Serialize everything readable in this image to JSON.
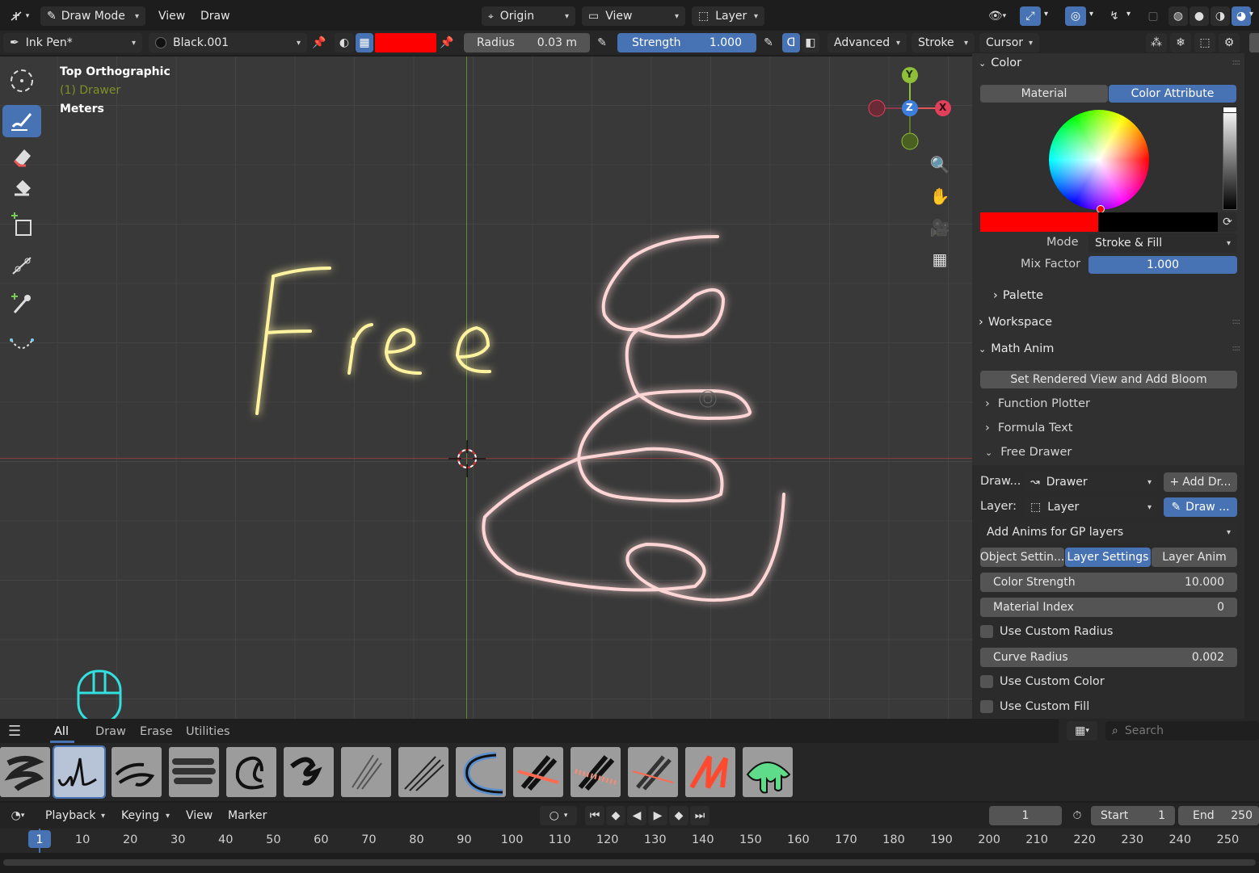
{
  "header": {
    "mode": "Draw Mode",
    "menu": [
      "View",
      "Draw"
    ],
    "origin": "Origin",
    "view_dd": "View",
    "layer_dd": "Layer"
  },
  "toolbar": {
    "brush": "Ink Pen*",
    "material": "Black.001",
    "color": "#ff0000",
    "radius_label": "Radius",
    "radius_value": "0.03 m",
    "strength_label": "Strength",
    "strength_value": "1.000",
    "advanced": "Advanced",
    "stroke": "Stroke",
    "cursor": "Cursor"
  },
  "viewport": {
    "view_name": "Top Orthographic",
    "object": "(1) Drawer",
    "units": "Meters",
    "gizmo": {
      "y": "Y",
      "z": "Z",
      "x": "X"
    },
    "drawing_text": "Free"
  },
  "panel": {
    "color_section": "Color",
    "tab_material": "Material",
    "tab_color_attr": "Color Attribute",
    "current_color": "#ff0000",
    "mode_label": "Mode",
    "mode_value": "Stroke & Fill",
    "mix_label": "Mix Factor",
    "mix_value": "1.000",
    "palette": "Palette",
    "workspace": "Workspace",
    "math_anim": "Math Anim",
    "set_bloom": "Set Rendered View and Add Bloom",
    "function_plotter": "Function Plotter",
    "formula_text": "Formula Text",
    "free_drawer": "Free Drawer",
    "drawer_label": "Draw...",
    "drawer_value": "Drawer",
    "add_drawer": "Add Dr...",
    "layer_label": "Layer:",
    "layer_value": "Layer",
    "draw_btn": "Draw ...",
    "add_anims": "Add Anims for GP layers",
    "tabs": [
      "Object Settin...",
      "Layer Settings",
      "Layer Anim"
    ],
    "color_strength_label": "Color Strength",
    "color_strength_value": "10.000",
    "material_index_label": "Material Index",
    "material_index_value": "0",
    "use_custom_radius": "Use Custom Radius",
    "curve_radius_label": "Curve Radius",
    "curve_radius_value": "0.002",
    "use_custom_color": "Use Custom Color",
    "use_custom_fill": "Use Custom Fill"
  },
  "brush_tabs": [
    "All",
    "Draw",
    "Erase",
    "Utilities"
  ],
  "search_placeholder": "Search",
  "timeline": {
    "menu": [
      "Playback",
      "Keying",
      "View",
      "Marker"
    ],
    "current_frame": "1",
    "start_label": "Start",
    "start": "1",
    "end_label": "End",
    "end": "250",
    "ticks": [
      "1",
      "10",
      "20",
      "30",
      "40",
      "50",
      "60",
      "70",
      "80",
      "90",
      "100",
      "110",
      "120",
      "130",
      "140",
      "150",
      "160",
      "170",
      "180",
      "190",
      "200",
      "210",
      "220",
      "230",
      "240",
      "250"
    ]
  }
}
